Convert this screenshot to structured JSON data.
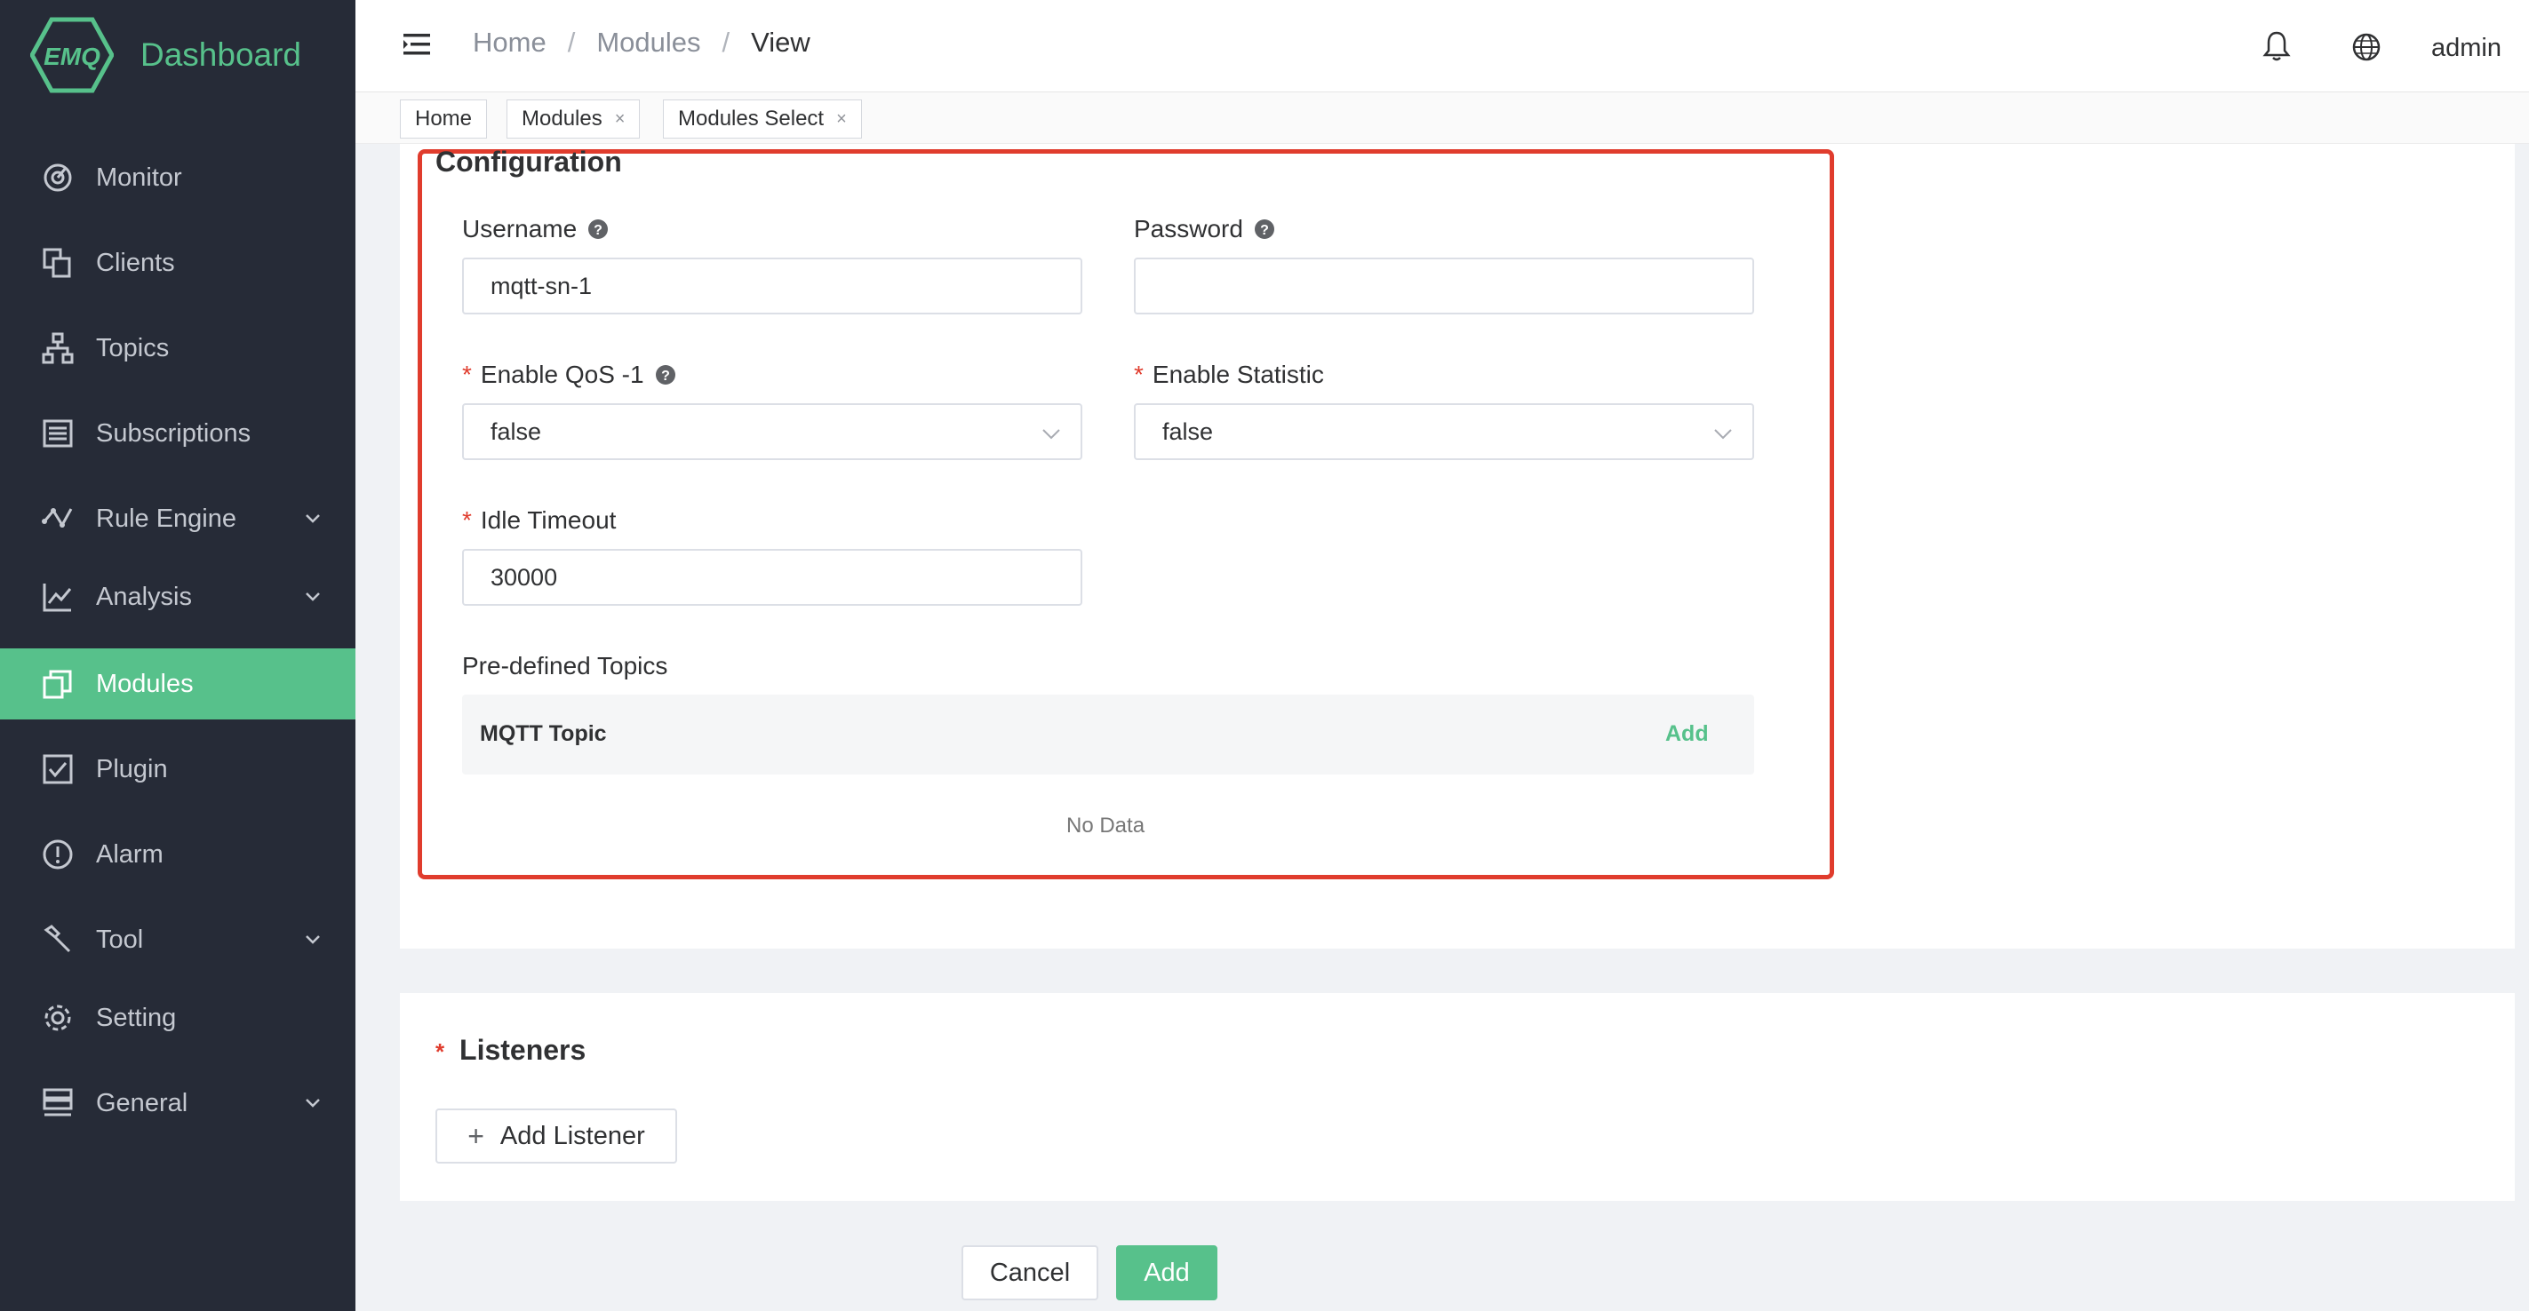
{
  "brand": {
    "logo_text": "EMQ",
    "name": "Dashboard",
    "accent": "#57c18b"
  },
  "sidebar": {
    "items": [
      {
        "label": "Monitor",
        "icon": "monitor-icon",
        "expandable": false,
        "active": false
      },
      {
        "label": "Clients",
        "icon": "clients-icon",
        "expandable": false,
        "active": false
      },
      {
        "label": "Topics",
        "icon": "topics-icon",
        "expandable": false,
        "active": false
      },
      {
        "label": "Subscriptions",
        "icon": "subscriptions-icon",
        "expandable": false,
        "active": false
      },
      {
        "label": "Rule Engine",
        "icon": "rule-engine-icon",
        "expandable": true,
        "active": false
      },
      {
        "label": "Analysis",
        "icon": "analysis-icon",
        "expandable": true,
        "active": false
      },
      {
        "label": "Modules",
        "icon": "modules-icon",
        "expandable": false,
        "active": true
      },
      {
        "label": "Plugin",
        "icon": "plugin-icon",
        "expandable": false,
        "active": false
      },
      {
        "label": "Alarm",
        "icon": "alarm-icon",
        "expandable": false,
        "active": false
      },
      {
        "label": "Tool",
        "icon": "tool-icon",
        "expandable": true,
        "active": false
      },
      {
        "label": "Setting",
        "icon": "setting-icon",
        "expandable": false,
        "active": false
      },
      {
        "label": "General",
        "icon": "general-icon",
        "expandable": true,
        "active": false
      }
    ]
  },
  "header": {
    "breadcrumb": [
      "Home",
      "Modules",
      "View"
    ],
    "user": "admin",
    "icons": [
      "menu-icon",
      "bell-icon",
      "globe-icon"
    ]
  },
  "tags": [
    {
      "label": "Home",
      "closable": false
    },
    {
      "label": "Modules",
      "closable": true
    },
    {
      "label": "Modules Select",
      "closable": true
    }
  ],
  "configuration": {
    "title": "Configuration",
    "username": {
      "label": "Username",
      "value": "mqtt-sn-1"
    },
    "password": {
      "label": "Password",
      "value": ""
    },
    "enable_qos": {
      "label": "Enable QoS -1",
      "value": "false",
      "required": true
    },
    "enable_statistic": {
      "label": "Enable Statistic",
      "value": "false",
      "required": true
    },
    "idle_timeout": {
      "label": "Idle Timeout",
      "value": "30000",
      "required": true
    },
    "predefined_topics": {
      "label": "Pre-defined Topics",
      "column": "MQTT Topic",
      "add_label": "Add",
      "empty_text": "No Data"
    },
    "required_mark": "*"
  },
  "listeners": {
    "title": "Listeners",
    "add_button": "Add Listener",
    "required": true
  },
  "footer": {
    "cancel_label": "Cancel",
    "add_label": "Add"
  },
  "colors": {
    "sidebar_bg": "#262b37",
    "active": "#57c18b",
    "highlight_border": "#e03c2d"
  }
}
